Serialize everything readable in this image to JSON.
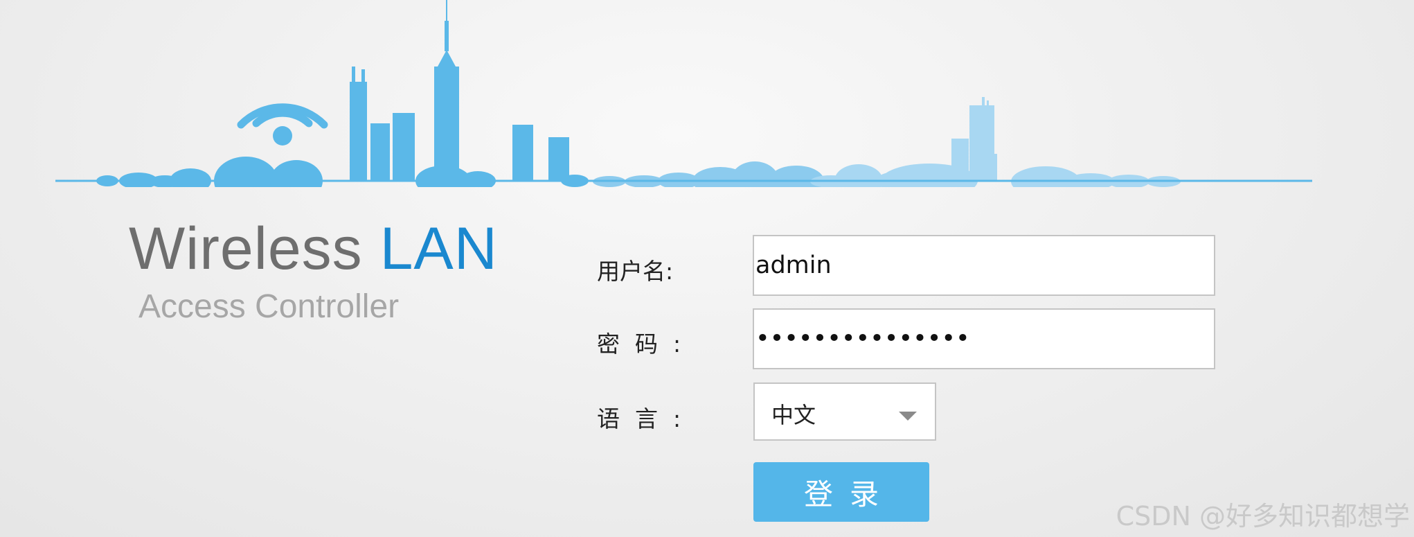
{
  "brand": {
    "title_main": "Wireless",
    "title_accent": "LAN",
    "subtitle": "Access Controller"
  },
  "form": {
    "username_label": "用户名",
    "username_value": "admin",
    "password_label": "密码",
    "password_value": "•••••••••••••••",
    "language_label": "语言",
    "language_selected": "中文",
    "colon": ":",
    "login_label": "登录"
  },
  "icons": {
    "skyline": "city-skyline-illustration",
    "wifi": "wifi-icon",
    "dropdown": "chevron-down-icon"
  },
  "colors": {
    "skyline_blue": "#5bb8e8",
    "skyline_light": "#a5d5f1",
    "brand_accent": "#1a88cf",
    "button_bg": "#54b6e9"
  },
  "watermark": "CSDN @好多知识都想学"
}
